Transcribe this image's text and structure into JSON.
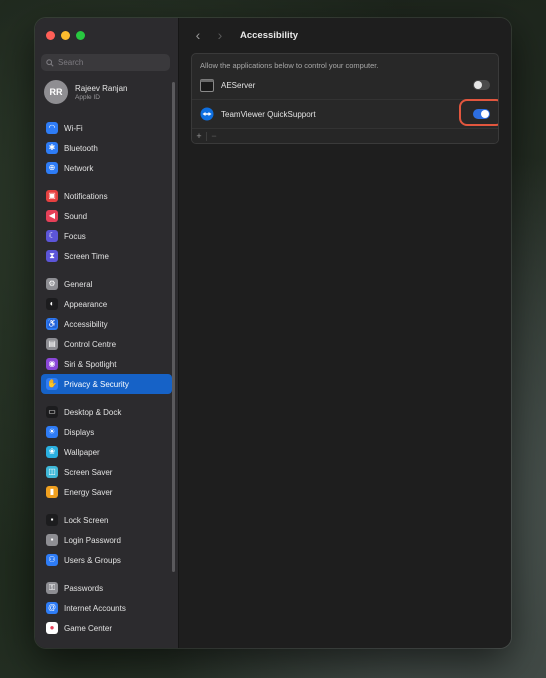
{
  "search": {
    "placeholder": "Search"
  },
  "user": {
    "initials": "RR",
    "name": "Rajeev Ranjan",
    "subtitle": "Apple ID"
  },
  "sidebar": {
    "items": [
      {
        "label": "Wi-Fi",
        "icon": "wifi-icon",
        "glyph": "◠",
        "color": "#2e7cf6"
      },
      {
        "label": "Bluetooth",
        "icon": "bluetooth-icon",
        "glyph": "✱",
        "color": "#2e7cf6"
      },
      {
        "label": "Network",
        "icon": "globe-icon",
        "glyph": "⊕",
        "color": "#2e7cf6"
      },
      {
        "label": "Notifications",
        "icon": "bell-icon",
        "glyph": "▣",
        "color": "#e64040"
      },
      {
        "label": "Sound",
        "icon": "speaker-icon",
        "glyph": "◀",
        "color": "#e64058"
      },
      {
        "label": "Focus",
        "icon": "moon-icon",
        "glyph": "☾",
        "color": "#5c55d8"
      },
      {
        "label": "Screen Time",
        "icon": "hourglass-icon",
        "glyph": "⧗",
        "color": "#5c55d8"
      },
      {
        "label": "General",
        "icon": "gear-icon",
        "glyph": "⚙",
        "color": "#8e8e93"
      },
      {
        "label": "Appearance",
        "icon": "appearance-icon",
        "glyph": "◐",
        "color": "#1c1c1e"
      },
      {
        "label": "Accessibility",
        "icon": "accessibility-icon",
        "glyph": "♿",
        "color": "#2e7cf6"
      },
      {
        "label": "Control Centre",
        "icon": "control-centre-icon",
        "glyph": "▤",
        "color": "#8e8e93"
      },
      {
        "label": "Siri & Spotlight",
        "icon": "siri-icon",
        "glyph": "◉",
        "color": "#8b47d8"
      },
      {
        "label": "Privacy & Security",
        "icon": "hand-icon",
        "glyph": "✋",
        "color": "#2e7cf6"
      },
      {
        "label": "Desktop & Dock",
        "icon": "dock-icon",
        "glyph": "▭",
        "color": "#1c1c1e"
      },
      {
        "label": "Displays",
        "icon": "sun-icon",
        "glyph": "☀",
        "color": "#2e7cf6"
      },
      {
        "label": "Wallpaper",
        "icon": "wallpaper-icon",
        "glyph": "❀",
        "color": "#2ab0e0"
      },
      {
        "label": "Screen Saver",
        "icon": "screensaver-icon",
        "glyph": "◫",
        "color": "#3fb8d8"
      },
      {
        "label": "Energy Saver",
        "icon": "battery-icon",
        "glyph": "▮",
        "color": "#f0a020"
      },
      {
        "label": "Lock Screen",
        "icon": "lock-icon",
        "glyph": "▪",
        "color": "#1c1c1e"
      },
      {
        "label": "Login Password",
        "icon": "login-lock-icon",
        "glyph": "▪",
        "color": "#8e8e93"
      },
      {
        "label": "Users & Groups",
        "icon": "users-icon",
        "glyph": "⚇",
        "color": "#2e7cf6"
      },
      {
        "label": "Passwords",
        "icon": "key-icon",
        "glyph": "⚿",
        "color": "#8e8e93"
      },
      {
        "label": "Internet Accounts",
        "icon": "at-icon",
        "glyph": "@",
        "color": "#2e7cf6"
      },
      {
        "label": "Game Center",
        "icon": "game-center-icon",
        "glyph": "●",
        "color": "#ffffff"
      }
    ]
  },
  "header": {
    "title": "Accessibility"
  },
  "panel": {
    "description": "Allow the applications below to control your computer.",
    "apps": [
      {
        "name": "AEServer",
        "enabled": false
      },
      {
        "name": "TeamViewer QuickSupport",
        "enabled": true
      }
    ],
    "add_label": "+",
    "remove_label": "−"
  },
  "colors": {
    "accent": "#1662c7",
    "toggle_on": "#2d6ee0",
    "highlight_ring": "#e2563e"
  }
}
